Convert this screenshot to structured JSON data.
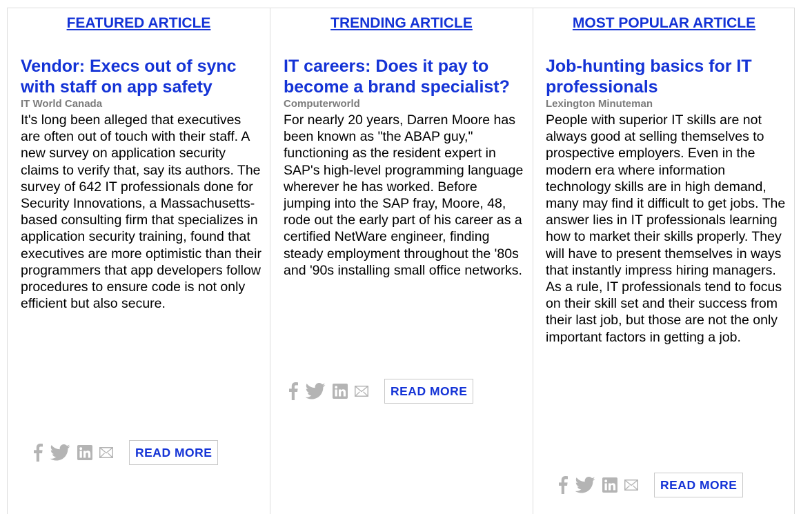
{
  "columns": [
    {
      "header": "FEATURED ARTICLE",
      "title": "Vendor: Execs out of sync with staff on app safety",
      "source": "IT World Canada",
      "body": "It's long been alleged that executives are often out of touch with their staff. A new survey on application security claims to verify that, say its authors. The survey of 642 IT professionals done for Security Innovations, a Massachusetts-based consulting firm that specializes in application security training, found that executives are more optimistic than their programmers that app developers follow procedures to ensure code is not only efficient but also secure.",
      "read_more": "READ MORE"
    },
    {
      "header": "TRENDING ARTICLE",
      "title": "IT careers: Does it pay to become a brand specialist?",
      "source": "Computerworld",
      "body": "For nearly 20 years, Darren Moore has been known as \"the ABAP guy,\" functioning as the resident expert in SAP's high-level programming language wherever he has worked. Before jumping into the SAP fray, Moore, 48, rode out the early part of his career as a certified NetWare engineer, finding steady employment throughout the '80s and '90s installing small office networks.",
      "read_more": "READ MORE"
    },
    {
      "header": "MOST POPULAR ARTICLE",
      "title": "Job-hunting basics for IT professionals",
      "source": "Lexington Minuteman",
      "body": "People with superior IT skills are not always good at selling themselves to prospective employers. Even in the modern era where information technology skills are in high demand, many may find it difficult to get jobs. The answer lies in IT professionals learning how to market their skills properly. They will have to present themselves in ways that instantly impress hiring managers. As a rule, IT professionals tend to focus on their skill set and their success from their last job, but those are not the only important factors in getting a job.",
      "read_more": "READ MORE"
    }
  ],
  "share_icons": [
    "facebook-icon",
    "twitter-icon",
    "linkedin-icon",
    "email-icon"
  ],
  "colors": {
    "link": "#1433d6",
    "source": "#7b7b7b",
    "icon": "#b4b4b4",
    "divider": "#dcdcdc"
  }
}
